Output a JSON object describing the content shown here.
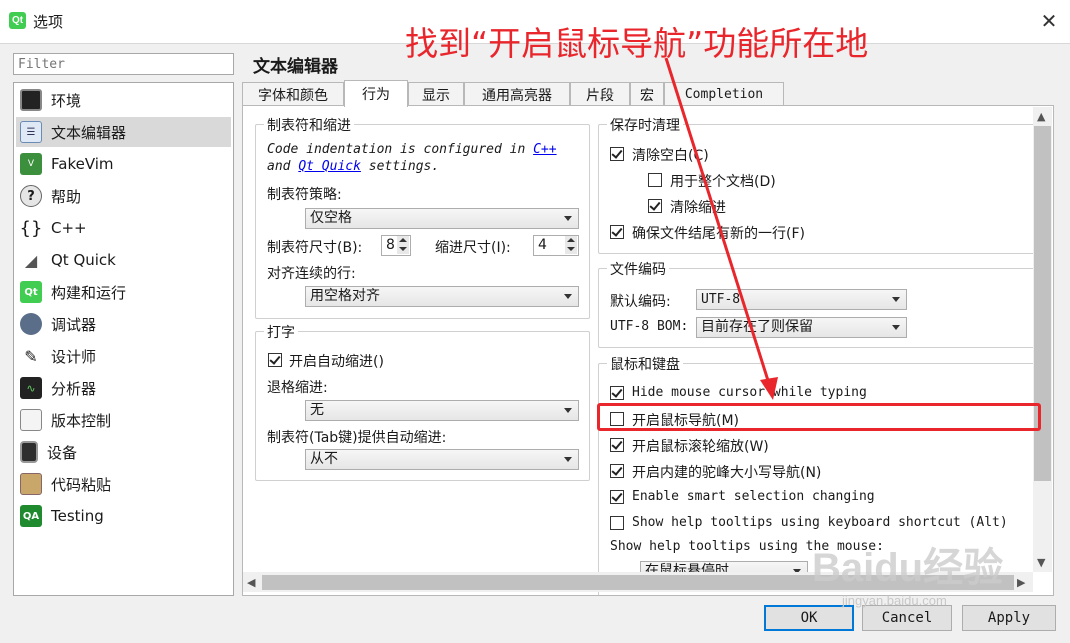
{
  "window": {
    "title": "选项",
    "app_icon": "Qt",
    "close": "✕"
  },
  "annotation": "找到“开启鼠标导航”功能所在地",
  "filter": {
    "placeholder": "Filter"
  },
  "sidebar": {
    "items": [
      {
        "label": "环境",
        "icon": "monitor-icon"
      },
      {
        "label": "文本编辑器",
        "icon": "text-editor-icon"
      },
      {
        "label": "FakeVim",
        "icon": "fakevim-icon"
      },
      {
        "label": "帮助",
        "icon": "help-icon"
      },
      {
        "label": "C++",
        "icon": "cpp-braces-icon"
      },
      {
        "label": "Qt Quick",
        "icon": "qt-quick-icon"
      },
      {
        "label": "构建和运行",
        "icon": "build-run-icon"
      },
      {
        "label": "调试器",
        "icon": "debugger-icon"
      },
      {
        "label": "设计师",
        "icon": "designer-icon"
      },
      {
        "label": "分析器",
        "icon": "analyzer-icon"
      },
      {
        "label": "版本控制",
        "icon": "version-control-icon"
      },
      {
        "label": "设备",
        "icon": "device-icon"
      },
      {
        "label": "代码粘贴",
        "icon": "code-paste-icon"
      },
      {
        "label": "Testing",
        "icon": "qa-icon"
      }
    ]
  },
  "page_title": "文本编辑器",
  "tabs": [
    "字体和颜色",
    "行为",
    "显示",
    "通用高亮器",
    "片段",
    "宏",
    "Completion"
  ],
  "tabs_indent": {
    "title": "制表符和缩进",
    "note_prefix": "Code indentation is configured in ",
    "note_link1": "C++",
    "note_and": "and ",
    "note_link2": "Qt Quick",
    "note_suffix": " settings.",
    "policy_label": "制表符策略:",
    "policy_value": "仅空格",
    "tab_size_label": "制表符尺寸(B):",
    "tab_size_value": "8",
    "indent_size_label": "缩进尺寸(I):",
    "indent_size_value": "4",
    "align_label": "对齐连续的行:",
    "align_value": "用空格对齐"
  },
  "typing": {
    "title": "打字",
    "auto_indent_label": "开启自动缩进()",
    "auto_indent_checked": true,
    "backspace_label": "退格缩进:",
    "backspace_value": "无",
    "tab_key_label": "制表符(Tab键)提供自动缩进:",
    "tab_key_value": "从不"
  },
  "cleanup": {
    "title": "保存时清理",
    "clean_whitespace": {
      "label": "清除空白(C)",
      "checked": true
    },
    "whole_document": {
      "label": "用于整个文档(D)",
      "checked": false
    },
    "clean_indent": {
      "label": "清除缩进",
      "checked": true
    },
    "ensure_newline": {
      "label": "确保文件结尾有新的一行(F)",
      "checked": true
    }
  },
  "encoding": {
    "title": "文件编码",
    "default_label": "默认编码:",
    "default_value": "UTF-8",
    "bom_label": "UTF-8 BOM:",
    "bom_value": "目前存在了则保留"
  },
  "mouse_keyboard": {
    "title": "鼠标和键盘",
    "items": [
      {
        "label": "Hide mouse cursor while typing",
        "checked": true
      },
      {
        "label": "开启鼠标导航(M)",
        "checked": false
      },
      {
        "label": "开启鼠标滚轮缩放(W)",
        "checked": true
      },
      {
        "label": "开启内建的驼峰大小写导航(N)",
        "checked": true
      },
      {
        "label": "Enable smart selection changing",
        "checked": true
      },
      {
        "label": "Show help tooltips using keyboard shortcut (Alt)",
        "checked": false
      }
    ],
    "tooltip_mouse_label": "Show help tooltips using the mouse:",
    "tooltip_mouse_value": "在鼠标悬停时"
  },
  "buttons": {
    "ok": "OK",
    "cancel": "Cancel",
    "apply": "Apply"
  },
  "watermark": "Baidu经验",
  "watermark_url": "jingyan.baidu.com",
  "colors": {
    "annotation": "#e8262c",
    "ok_border": "#0078d7",
    "link": "#0000ee"
  }
}
